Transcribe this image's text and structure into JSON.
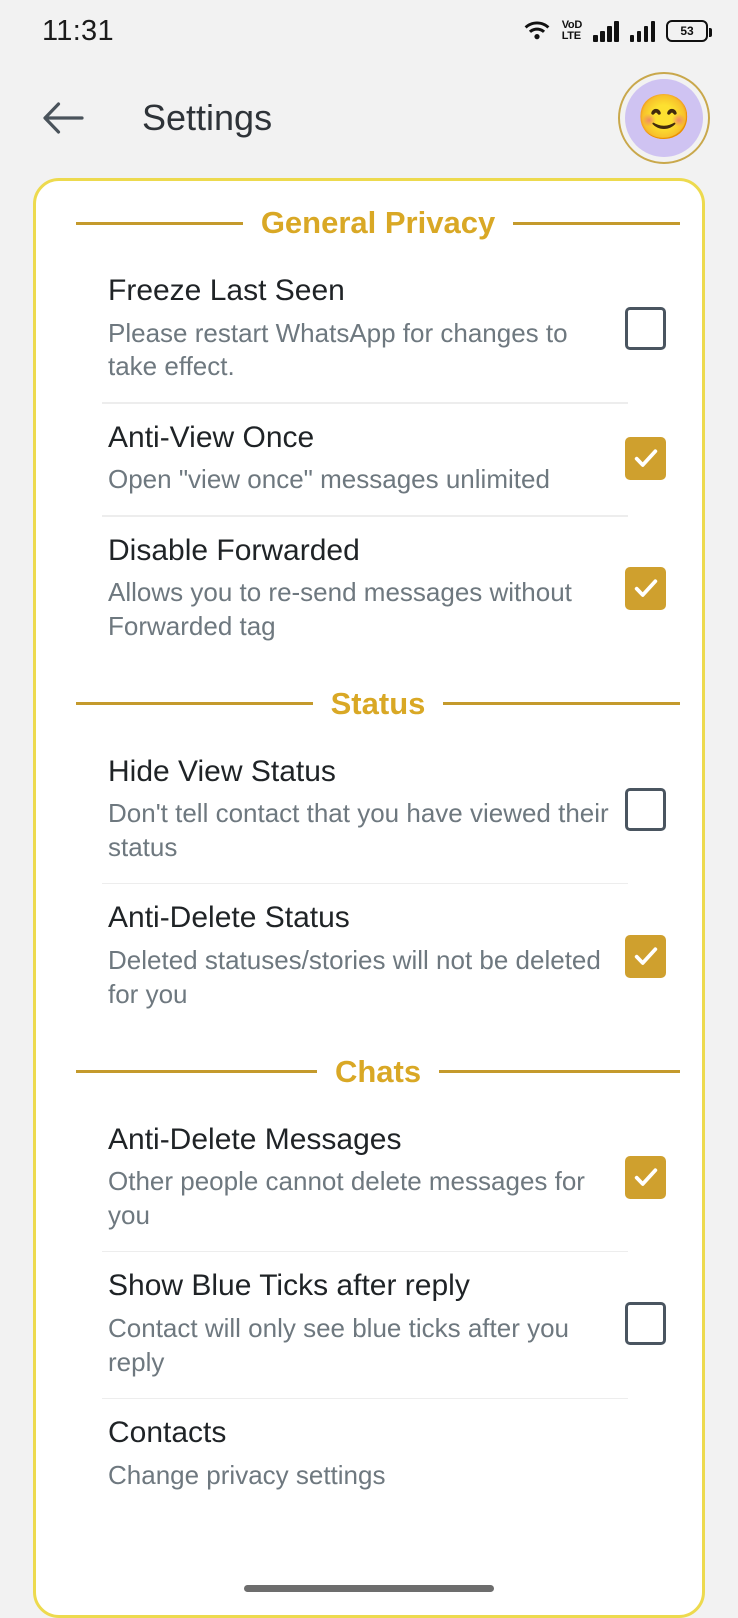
{
  "statusbar": {
    "time": "11:31",
    "battery_level": "53",
    "icons": [
      "wifi-icon",
      "volte-icon",
      "signal-bars-sim1-icon",
      "signal-bars-sim2-icon",
      "battery-icon"
    ],
    "volte_line1": "VoD",
    "volte_line2": "LTE"
  },
  "appbar": {
    "back_label": "←",
    "title": "Settings",
    "avatar_emoji": "😊",
    "ring_color": "#C9A84C",
    "avatar_bg": "#CFC3F2"
  },
  "theme": {
    "accent_gold": "#D9A825",
    "rule_gold": "#C49A2C",
    "card_border": "#EDDA4E",
    "checkbox_on": "#CFA02E",
    "checkbox_off_border": "#4A5560",
    "page_bg": "#F2F2F2"
  },
  "sections": [
    {
      "header": "General Privacy",
      "items": [
        {
          "title": "Freeze Last Seen",
          "subtitle": "Please restart WhatsApp for changes to take effect.",
          "checked": false
        },
        {
          "title": "Anti-View Once",
          "subtitle": "Open \"view once\" messages unlimited",
          "checked": true
        },
        {
          "title": "Disable Forwarded",
          "subtitle": "Allows you to re-send messages without Forwarded tag",
          "checked": true
        }
      ]
    },
    {
      "header": "Status",
      "items": [
        {
          "title": "Hide View Status",
          "subtitle": "Don't tell contact that you have viewed their status",
          "checked": false
        },
        {
          "title": "Anti-Delete Status",
          "subtitle": "Deleted statuses/stories will not be deleted for you",
          "checked": true
        }
      ]
    },
    {
      "header": "Chats",
      "items": [
        {
          "title": "Anti-Delete Messages",
          "subtitle": "Other people cannot delete messages for you",
          "checked": true
        },
        {
          "title": "Show Blue Ticks after reply",
          "subtitle": "Contact will only see blue ticks after you reply",
          "checked": false
        },
        {
          "title": "Contacts",
          "subtitle": "Change privacy settings",
          "checked": null
        }
      ]
    }
  ]
}
